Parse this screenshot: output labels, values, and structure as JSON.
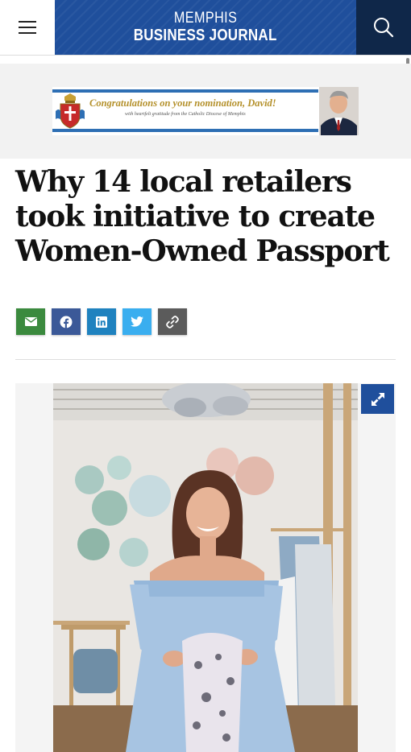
{
  "header": {
    "brand_line1": "MEMPHIS",
    "brand_line2": "BUSINESS JOURNAL",
    "menu_icon": "hamburger-icon",
    "search_icon": "search-icon",
    "brand_color": "#1f4f9c",
    "search_bg": "#0f2749"
  },
  "ad": {
    "headline": "Congratulations on your nomination, David!",
    "subline": "with heartfelt gratitude from the Catholic Diocese of Memphis",
    "accent_color": "#2e6fb4"
  },
  "article": {
    "title": "Why 14 local retailers took initiative to create Women-Owned Passport"
  },
  "share": [
    {
      "name": "email",
      "icon": "envelope-icon",
      "color": "#3b8a3e"
    },
    {
      "name": "facebook",
      "icon": "facebook-icon",
      "color": "#3b5998"
    },
    {
      "name": "linkedin",
      "icon": "linkedin-icon",
      "color": "#1f82bf"
    },
    {
      "name": "twitter",
      "icon": "twitter-icon",
      "color": "#3aaeef"
    },
    {
      "name": "copy-link",
      "icon": "link-icon",
      "color": "#5b5b5b"
    }
  ],
  "media": {
    "expand_icon": "expand-icon"
  }
}
